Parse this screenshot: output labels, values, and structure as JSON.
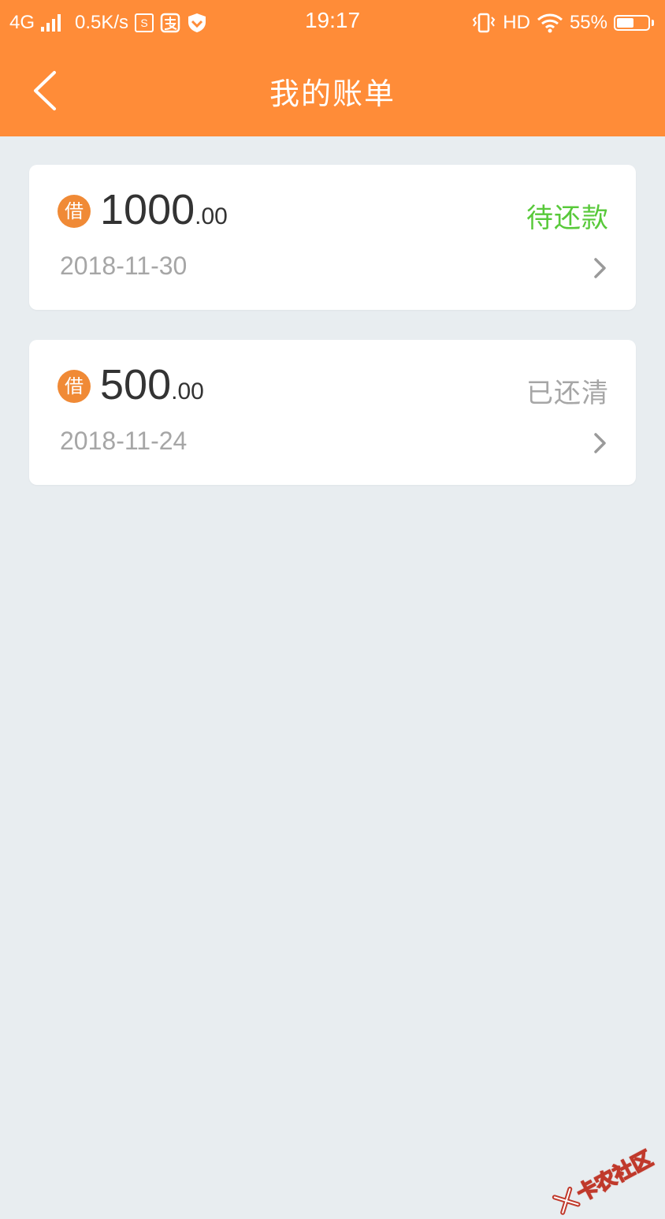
{
  "status_bar": {
    "network": "4G",
    "speed": "0.5K/s",
    "sq_icon_glyph": "S",
    "time": "19:17",
    "hd": "HD",
    "battery": "55%",
    "battery_level": 0.55,
    "icons": [
      "signal-icon",
      "app-s-icon",
      "app-alipay-icon",
      "shield-icon",
      "vibrate-icon",
      "wifi-icon",
      "battery-icon"
    ]
  },
  "header": {
    "title": "我的账单",
    "back_icon": "chevron-left-icon"
  },
  "bills": [
    {
      "badge": "借",
      "amount_int": "1000",
      "amount_dec": ".00",
      "status": "待还款",
      "status_color": "#58c93a",
      "date": "2018-11-30"
    },
    {
      "badge": "借",
      "amount_int": "500",
      "amount_dec": ".00",
      "status": "已还清",
      "status_color": "#a6a6a6",
      "date": "2018-11-24"
    }
  ],
  "watermark": {
    "text": "卡农社区"
  },
  "colors": {
    "accent": "#ff8c38",
    "background": "#e8edf0",
    "badge": "#f08a36"
  }
}
